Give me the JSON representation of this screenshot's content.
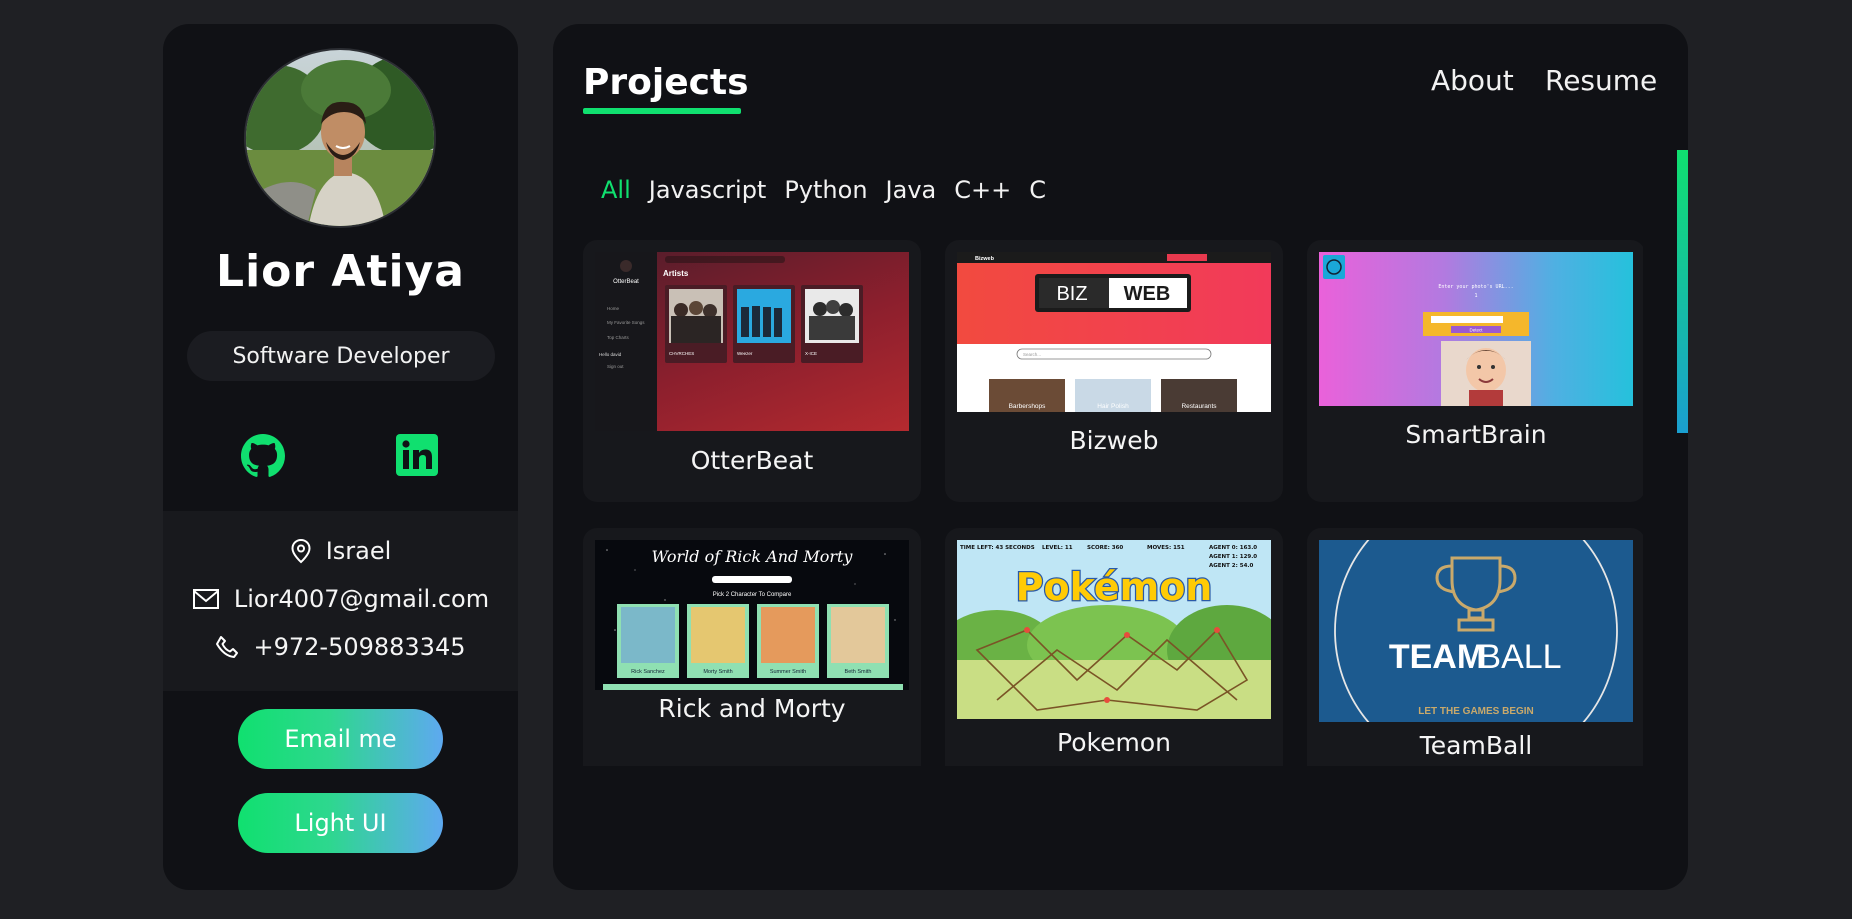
{
  "profile": {
    "name": "Lior Atiya",
    "role": "Software Developer",
    "location": "Israel",
    "email": "Lior4007@gmail.com",
    "phone": "+972-509883345",
    "buttons": {
      "email": "Email me",
      "theme": "Light UI"
    }
  },
  "nav": {
    "title": "Projects",
    "links": {
      "about": "About",
      "resume": "Resume"
    }
  },
  "filters": [
    "All",
    "Javascript",
    "Python",
    "Java",
    "C++",
    "C"
  ],
  "projects": [
    {
      "name": "OtterBeat"
    },
    {
      "name": "Bizweb"
    },
    {
      "name": "SmartBrain"
    },
    {
      "name": "Rick and Morty"
    },
    {
      "name": "Pokemon"
    },
    {
      "name": "TeamBall"
    }
  ],
  "thumbs": {
    "otterbeat": {
      "brand": "OtterBeat",
      "section": "Artists",
      "menu": [
        "Home",
        "My Favorite Songs",
        "Top Charts",
        "Hello david",
        "Sign out"
      ],
      "artists": [
        "CHVRCHES",
        "Weezer",
        "X-ICE"
      ]
    },
    "bizweb": {
      "brand": "Bizweb",
      "logo_left": "BIZ",
      "logo_right": "WEB",
      "search": "Search...",
      "tiles": [
        "Barbershops",
        "Hair Polish",
        "Restaurants"
      ]
    },
    "smartbrain": {
      "line1": "Enter your photo's URL...",
      "line2": "1",
      "button": "Detect"
    },
    "rick": {
      "title": "World of Rick And Morty",
      "subtitle": "Pick 2 Character To Compare",
      "chars": [
        "Rick Sanchez",
        "Morty Smith",
        "Summer Smith",
        "Beth Smith"
      ]
    },
    "pokemon": {
      "time": "TIME LEFT: 43 SECONDS",
      "level": "LEVEL: 11",
      "score": "SCORE: 360",
      "moves": "MOVES: 151",
      "agent0": "AGENT 0: 163.0",
      "agent1": "AGENT 1: 129.0",
      "agent2": "AGENT 2: 54.0",
      "logo": "Pokémon"
    },
    "teamball": {
      "title_bold": "TEAM",
      "title_light": "BALL",
      "tagline": "LET THE GAMES BEGIN"
    }
  },
  "colors": {
    "accent": "#10e06f",
    "panel": "#101115",
    "background": "#1f2024"
  },
  "icons": [
    "github-icon",
    "linkedin-icon",
    "location-pin-icon",
    "mail-icon",
    "phone-icon"
  ]
}
